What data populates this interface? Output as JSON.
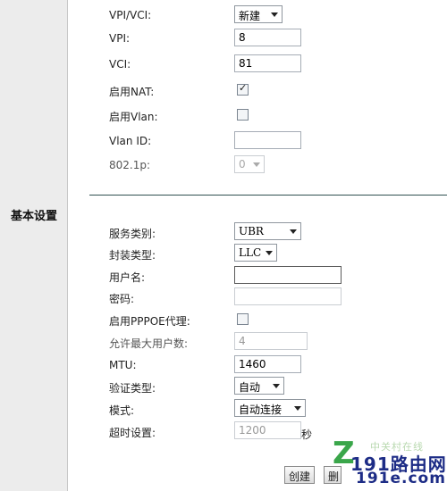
{
  "sidebar": {
    "section_title": "基本设置"
  },
  "form": {
    "vpi_vci": {
      "label": "VPI/VCI:",
      "selected": "新建"
    },
    "vpi": {
      "label": "VPI:",
      "value": "8"
    },
    "vci": {
      "label": "VCI:",
      "value": "81"
    },
    "enable_nat": {
      "label": "启用NAT:",
      "checked": true
    },
    "enable_vlan": {
      "label": "启用Vlan:",
      "checked": false
    },
    "vlan_id": {
      "label": "Vlan ID:",
      "value": ""
    },
    "dot1p": {
      "label": "802.1p:",
      "selected": "0"
    },
    "service_type": {
      "label": "服务类别:",
      "selected": "UBR"
    },
    "encapsulation": {
      "label": "封装类型:",
      "selected": "LLC"
    },
    "username": {
      "label": "用户名:",
      "value": ""
    },
    "password": {
      "label": "密码:",
      "value": ""
    },
    "pppoe_proxy": {
      "label": "启用PPPOE代理:",
      "checked": false
    },
    "max_users": {
      "label": "允许最大用户数:",
      "value": "4"
    },
    "mtu": {
      "label": "MTU:",
      "value": "1460"
    },
    "auth_type": {
      "label": "验证类型:",
      "selected": "自动"
    },
    "mode": {
      "label": "模式:",
      "selected": "自动连接"
    },
    "timeout": {
      "label": "超时设置:",
      "value": "1200",
      "unit": "秒"
    }
  },
  "buttons": {
    "create": "创建",
    "delete": "删"
  },
  "watermark": {
    "logo_letter": "Z",
    "line1": "191路由网",
    "line2": "191e.com",
    "faint": "中关村在线"
  },
  "colors": {
    "divider": "#2f4f4f",
    "left_panel": "#ececec",
    "watermark_green": "#3aa64a",
    "watermark_blue": "#1d2c86"
  }
}
